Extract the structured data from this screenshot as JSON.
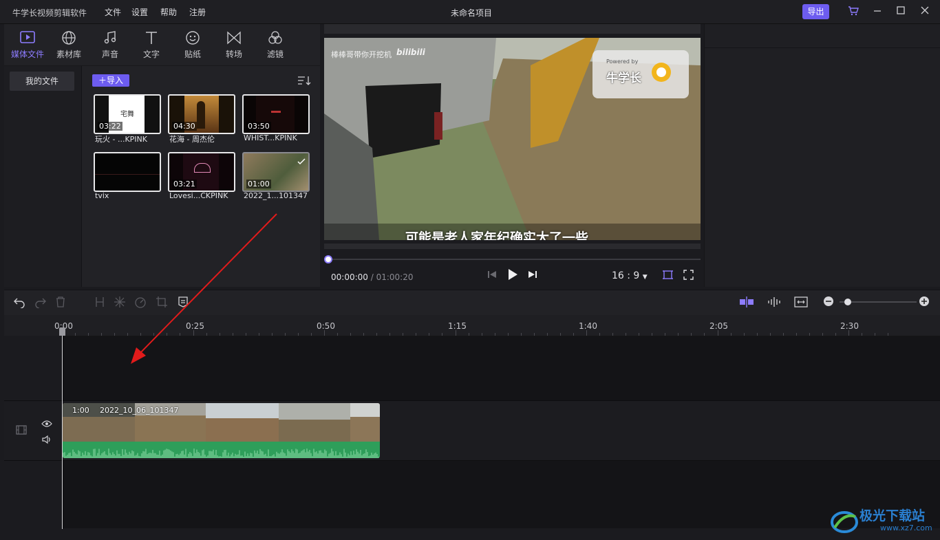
{
  "app": {
    "title": "牛学长视频剪辑软件",
    "menus": [
      "文件",
      "设置",
      "帮助",
      "注册"
    ],
    "project_title": "未命名项目",
    "export_label": "导出",
    "accent": "#6d5cf0"
  },
  "media_tabs": [
    {
      "label": "媒体文件",
      "icon": "media-icon",
      "active": true
    },
    {
      "label": "素材库",
      "icon": "globe-icon"
    },
    {
      "label": "声音",
      "icon": "music-icon"
    },
    {
      "label": "文字",
      "icon": "text-icon"
    },
    {
      "label": "贴纸",
      "icon": "sticker-icon"
    },
    {
      "label": "转场",
      "icon": "transition-icon"
    },
    {
      "label": "滤镜",
      "icon": "filter-icon"
    }
  ],
  "sidebar": {
    "my_files": "我的文件"
  },
  "import_label": "导入",
  "media_items": [
    {
      "name": "玩火 - ...KPINK",
      "duration": "03:22",
      "overlay_text": "宅舞"
    },
    {
      "name": "花海 - 周杰伦",
      "duration": "04:30"
    },
    {
      "name": "WHIST...KPINK",
      "duration": "03:50"
    },
    {
      "name": "tvix",
      "duration": ""
    },
    {
      "name": "Lovesi...CKPINK",
      "duration": "03:21"
    },
    {
      "name": "2022_1...101347",
      "duration": "01:00"
    }
  ],
  "preview": {
    "watermark_left": "棒棒哥带你开挖机",
    "brand_small": "bilibili",
    "powered_by": "Powered by",
    "brand": "牛学长",
    "subtitle": "可能是老人家年纪确实大了一些",
    "current_time": "00:00:00",
    "total_time": "01:00:20",
    "aspect_ratio": "16 : 9",
    "progress": 0
  },
  "timeline": {
    "ticks": [
      "0:00",
      "0:25",
      "0:50",
      "1:15",
      "1:40",
      "2:05",
      "2:30"
    ],
    "clip_duration": "1:00",
    "clip_name": "2022_10_06_101347"
  },
  "site_watermark": {
    "name": "极光下载站",
    "url": "www.xz7.com"
  }
}
